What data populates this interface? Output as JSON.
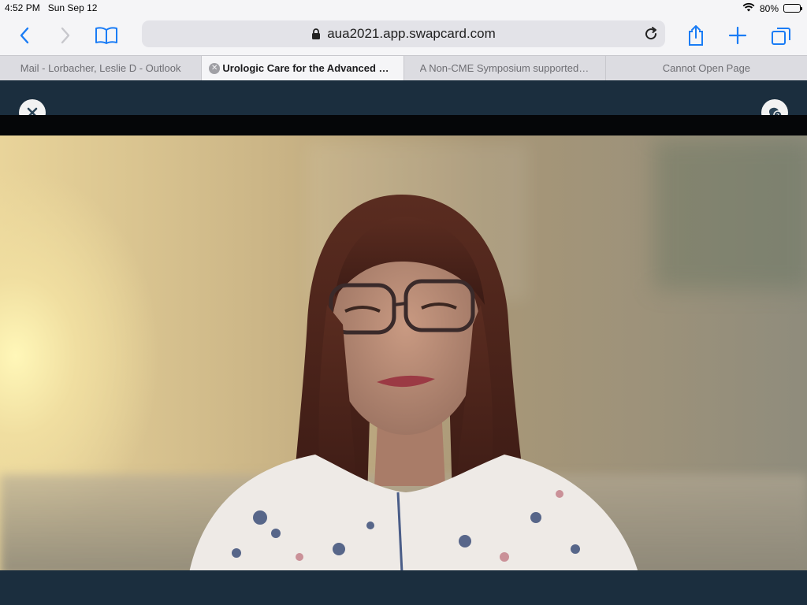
{
  "status_bar": {
    "time": "4:52 PM",
    "date": "Sun Sep 12",
    "battery_text": "80%",
    "battery_level": 0.8
  },
  "toolbar": {
    "url": "aua2021.app.swapcard.com",
    "icons": {
      "back": "chevron-left-icon",
      "forward": "chevron-right-icon",
      "bookmarks": "book-icon",
      "lock": "lock-icon",
      "reload": "reload-icon",
      "share": "share-icon",
      "new_tab": "plus-icon",
      "tabs": "tabs-icon"
    }
  },
  "tabs": [
    {
      "label": "Mail - Lorbacher, Leslie D - Outlook",
      "active": false
    },
    {
      "label": "Urologic Care for the Advanced Pr...",
      "active": true
    },
    {
      "label": "A Non-CME Symposium supported b...",
      "active": false
    },
    {
      "label": "Cannot Open Page",
      "active": false
    }
  ],
  "page": {
    "close_icon": "close-icon",
    "help_icon": "chat-help-icon"
  },
  "colors": {
    "accent": "#1a7cf5",
    "page_background": "#1b2e3e"
  }
}
